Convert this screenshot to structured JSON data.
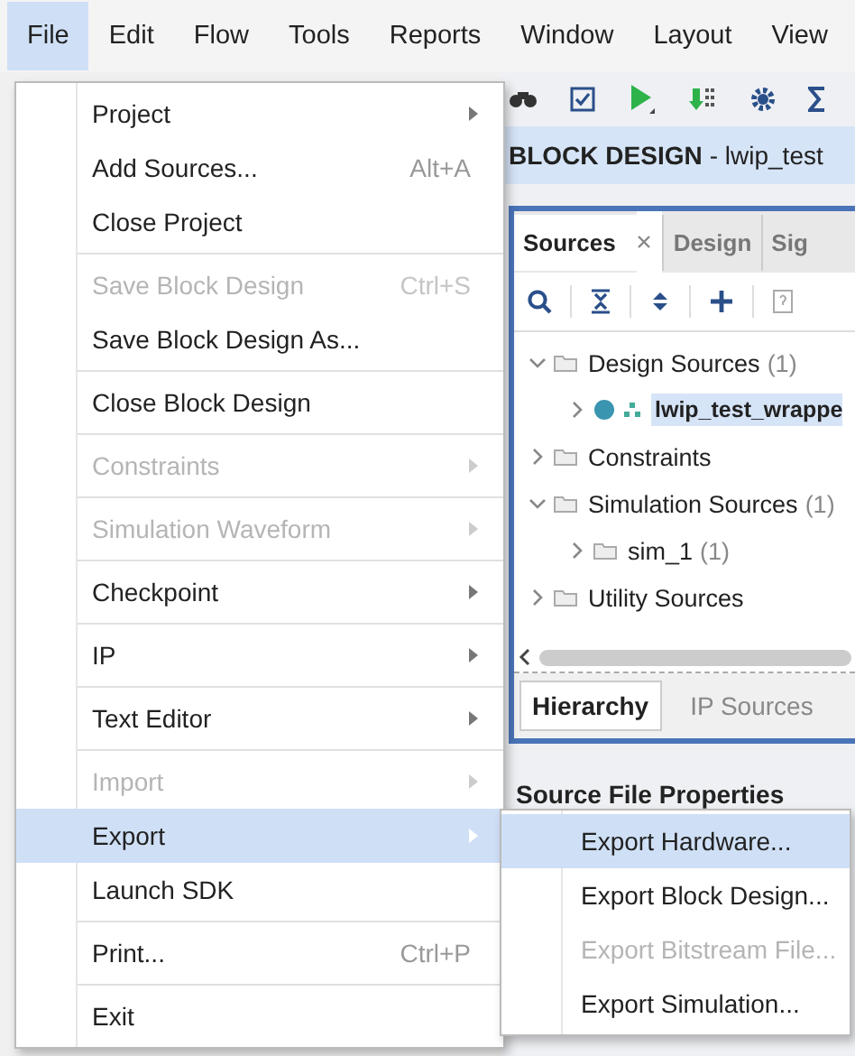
{
  "menu_bar": [
    {
      "label": "File",
      "selected": true
    },
    {
      "label": "Edit",
      "selected": false
    },
    {
      "label": "Flow",
      "selected": false
    },
    {
      "label": "Tools",
      "selected": false
    },
    {
      "label": "Reports",
      "selected": false
    },
    {
      "label": "Window",
      "selected": false
    },
    {
      "label": "Layout",
      "selected": false
    },
    {
      "label": "View",
      "selected": false
    }
  ],
  "header": {
    "title": "BLOCK DESIGN",
    "subtitle": "- lwip_test"
  },
  "sources_panel": {
    "tabs": [
      {
        "label": "Sources",
        "selected": true,
        "closable": true
      },
      {
        "label": "Design",
        "selected": false,
        "closable": false
      },
      {
        "label": "Sig",
        "selected": false,
        "closable": false
      }
    ],
    "tree": [
      {
        "label": "Design Sources",
        "count": "(1)",
        "expanded": true,
        "selected": false,
        "children": [
          {
            "label": "lwip_test_wrappe",
            "expanded": false,
            "selected": true,
            "kind": "module"
          }
        ]
      },
      {
        "label": "Constraints",
        "expanded": false,
        "selected": false
      },
      {
        "label": "Simulation Sources",
        "count": "(1)",
        "expanded": true,
        "selected": false,
        "children": [
          {
            "label": "sim_1",
            "count": "(1)",
            "expanded": false,
            "selected": false
          }
        ]
      },
      {
        "label": "Utility Sources",
        "expanded": false,
        "selected": false
      }
    ],
    "bottom_tabs": [
      {
        "label": "Hierarchy",
        "selected": true
      },
      {
        "label": "IP Sources",
        "selected": false
      }
    ]
  },
  "properties_heading": "Source File Properties",
  "file_menu": [
    [
      {
        "label": "Project",
        "submenu": true,
        "disabled": false,
        "selected": false
      },
      {
        "label": "Add Sources...",
        "shortcut": "Alt+A",
        "submenu": false,
        "disabled": false,
        "selected": false
      },
      {
        "label": "Close Project",
        "submenu": false,
        "disabled": false,
        "selected": false
      }
    ],
    [
      {
        "label": "Save Block Design",
        "shortcut": "Ctrl+S",
        "submenu": false,
        "disabled": true,
        "selected": false
      },
      {
        "label": "Save Block Design As...",
        "submenu": false,
        "disabled": false,
        "selected": false
      }
    ],
    [
      {
        "label": "Close Block Design",
        "submenu": false,
        "disabled": false,
        "selected": false
      }
    ],
    [
      {
        "label": "Constraints",
        "submenu": true,
        "disabled": true,
        "selected": false
      }
    ],
    [
      {
        "label": "Simulation Waveform",
        "submenu": true,
        "disabled": true,
        "selected": false
      }
    ],
    [
      {
        "label": "Checkpoint",
        "submenu": true,
        "disabled": false,
        "selected": false
      }
    ],
    [
      {
        "label": "IP",
        "submenu": true,
        "disabled": false,
        "selected": false
      }
    ],
    [
      {
        "label": "Text Editor",
        "submenu": true,
        "disabled": false,
        "selected": false
      }
    ],
    [
      {
        "label": "Import",
        "submenu": true,
        "disabled": true,
        "selected": false
      },
      {
        "label": "Export",
        "submenu": true,
        "disabled": false,
        "selected": true
      },
      {
        "label": "Launch SDK",
        "submenu": false,
        "disabled": false,
        "selected": false
      }
    ],
    [
      {
        "label": "Print...",
        "shortcut": "Ctrl+P",
        "submenu": false,
        "disabled": false,
        "selected": false
      }
    ],
    [
      {
        "label": "Exit",
        "submenu": false,
        "disabled": false,
        "selected": false
      }
    ]
  ],
  "export_submenu": [
    {
      "label": "Export Hardware...",
      "disabled": false,
      "selected": true
    },
    {
      "label": "Export Block Design...",
      "disabled": false,
      "selected": false
    },
    {
      "label": "Export Bitstream File...",
      "disabled": true,
      "selected": false
    },
    {
      "label": "Export Simulation...",
      "disabled": false,
      "selected": false
    }
  ]
}
